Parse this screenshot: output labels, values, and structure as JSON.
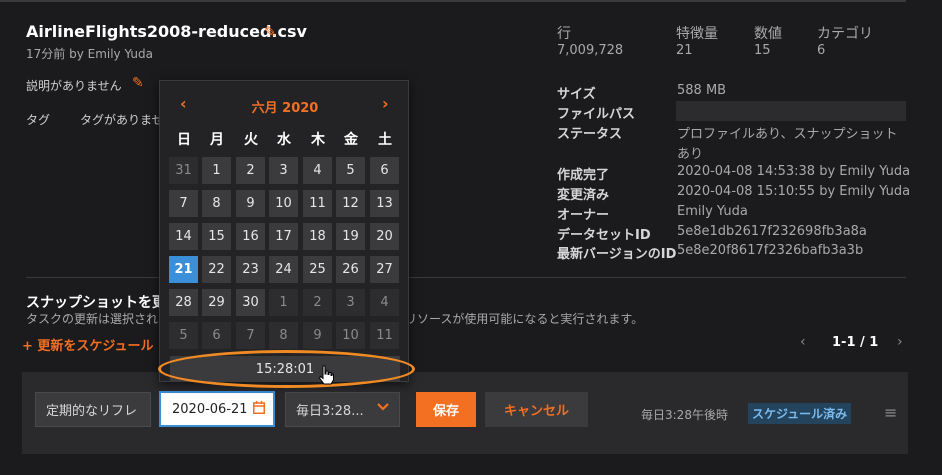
{
  "dataset": {
    "filename": "AirlineFlights2008-reduced.csv",
    "modified": "17分前 by Emily Yuda",
    "description": "説明がありません",
    "tags_label": "タグ",
    "tags_value": "タグがありませ"
  },
  "stats": {
    "rows_label": "行",
    "rows_value": "7,009,728",
    "features_label": "特徴量",
    "features_value": "21",
    "numeric_label": "数値",
    "numeric_value": "15",
    "category_label": "カテゴリ",
    "category_value": "6"
  },
  "meta": {
    "size_k": "サイズ",
    "size_v": "588 MB",
    "path_k": "ファイルパス",
    "status_k": "ステータス",
    "status_v1": "プロファイルあり、スナップショット",
    "status_v2": "あり",
    "created_k": "作成完了",
    "created_v": "2020-04-08 14:53:38 by Emily Yuda",
    "updated_k": "変更済み",
    "updated_v": "2020-04-08 15:10:55 by Emily Yuda",
    "owner_k": "オーナー",
    "owner_v": "Emily Yuda",
    "dsid_k": "データセットID",
    "dsid_v": "5e8e1db2617f232698fb3a8a",
    "verid_k": "最新バージョンのID",
    "verid_v": "5e8e20f8617f2326bafb3a3b"
  },
  "snapshot": {
    "title": "スナップショットを更",
    "desc_left": "タスクの更新は選択され",
    "desc_right": "リソースが使用可能になると実行されます。",
    "add_schedule": "+ 更新をスケジュール",
    "pager": "1-1 / 1"
  },
  "schedule_row": {
    "type_value": "定期的なリフレ",
    "date_value": "2020-06-21",
    "freq_value": "毎日3:28...",
    "save": "保存",
    "cancel": "キャンセル",
    "next_run": "毎日3:28午後時",
    "badge": "スケジュール済み"
  },
  "calendar": {
    "month": "六月 2020",
    "prev": "‹",
    "next": "›",
    "weekdays": [
      "日",
      "月",
      "火",
      "水",
      "木",
      "金",
      "土"
    ],
    "weeks": [
      [
        "31",
        "1",
        "2",
        "3",
        "4",
        "5",
        "6"
      ],
      [
        "7",
        "8",
        "9",
        "10",
        "11",
        "12",
        "13"
      ],
      [
        "14",
        "15",
        "16",
        "17",
        "18",
        "19",
        "20"
      ],
      [
        "21",
        "22",
        "23",
        "24",
        "25",
        "26",
        "27"
      ],
      [
        "28",
        "29",
        "30",
        "1",
        "2",
        "3",
        "4"
      ],
      [
        "5",
        "6",
        "7",
        "8",
        "9",
        "10",
        "11"
      ]
    ],
    "selected": "21",
    "time": "15:28:01"
  },
  "icons": {
    "pencil": "pencil-icon",
    "calendar": "calendar-icon",
    "chevron": "chevron-down-icon",
    "menu": "menu-icon"
  },
  "colors": {
    "accent": "#f36f21",
    "selected": "#3b8fd9",
    "background": "#1b1b1d"
  }
}
